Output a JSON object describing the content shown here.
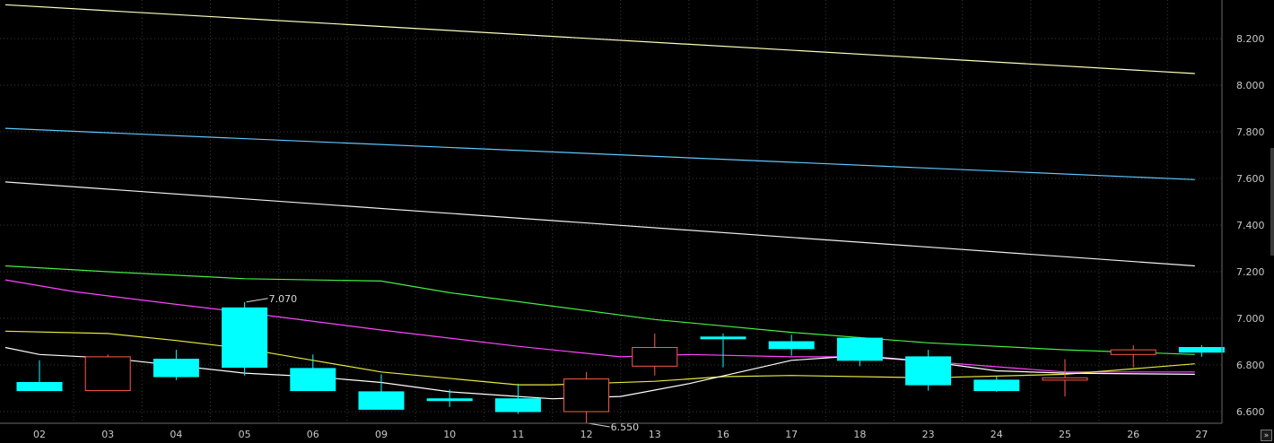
{
  "chart_data": {
    "type": "candlestick",
    "categories": [
      "02",
      "03",
      "04",
      "05",
      "06",
      "09",
      "10",
      "11",
      "12",
      "13",
      "16",
      "17",
      "18",
      "23",
      "24",
      "25",
      "26",
      "27"
    ],
    "ylim": [
      6.56,
      8.3
    ],
    "y_ticks": [
      "8.200",
      "8.000",
      "7.800",
      "7.600",
      "7.400",
      "7.200",
      "7.000",
      "6.800",
      "6.600"
    ],
    "grid": true,
    "colors": {
      "up": "#ff5a4a",
      "down": "#00ffff",
      "background": "#000000",
      "grid": "#3a3a3a",
      "axis_text": "#c8c8c8"
    },
    "candles": [
      {
        "o": 6.725,
        "h": 6.82,
        "l": 6.69,
        "c": 6.69
      },
      {
        "o": 6.69,
        "h": 6.845,
        "l": 6.69,
        "c": 6.835
      },
      {
        "o": 6.825,
        "h": 6.865,
        "l": 6.735,
        "c": 6.75
      },
      {
        "o": 7.045,
        "h": 7.07,
        "l": 6.755,
        "c": 6.79
      },
      {
        "o": 6.785,
        "h": 6.845,
        "l": 6.69,
        "c": 6.69
      },
      {
        "o": 6.685,
        "h": 6.76,
        "l": 6.61,
        "c": 6.61
      },
      {
        "o": 6.655,
        "h": 6.695,
        "l": 6.62,
        "c": 6.655
      },
      {
        "o": 6.655,
        "h": 6.72,
        "l": 6.59,
        "c": 6.6
      },
      {
        "o": 6.6,
        "h": 6.77,
        "l": 6.55,
        "c": 6.74
      },
      {
        "o": 6.795,
        "h": 6.935,
        "l": 6.755,
        "c": 6.875
      },
      {
        "o": 6.92,
        "h": 6.935,
        "l": 6.79,
        "c": 6.92
      },
      {
        "o": 6.9,
        "h": 6.93,
        "l": 6.84,
        "c": 6.87
      },
      {
        "o": 6.915,
        "h": 6.92,
        "l": 6.795,
        "c": 6.82
      },
      {
        "o": 6.835,
        "h": 6.865,
        "l": 6.69,
        "c": 6.715
      },
      {
        "o": 6.735,
        "h": 6.75,
        "l": 6.685,
        "c": 6.69
      },
      {
        "o": 6.735,
        "h": 6.825,
        "l": 6.665,
        "c": 6.745
      },
      {
        "o": 6.845,
        "h": 6.885,
        "l": 6.79,
        "c": 6.865
      },
      {
        "o": 6.875,
        "h": 6.885,
        "l": 6.835,
        "c": 6.855
      }
    ],
    "overlays": [
      {
        "color": "#ffffc0",
        "x": [
          -0.5,
          16.9
        ],
        "y": [
          8.345,
          8.05
        ]
      },
      {
        "color": "#5fc8ff",
        "x": [
          -0.5,
          16.9
        ],
        "y": [
          7.815,
          7.595
        ]
      },
      {
        "color": "#f0f0f0",
        "x": [
          -0.5,
          16.9
        ],
        "y": [
          7.585,
          7.225
        ]
      },
      {
        "color": "#44ee44",
        "x": [
          -0.5,
          1,
          3,
          5,
          6,
          9,
          11,
          13,
          15,
          16.9
        ],
        "y": [
          7.225,
          7.2,
          7.17,
          7.16,
          7.11,
          6.995,
          6.94,
          6.895,
          6.865,
          6.845
        ]
      },
      {
        "color": "#ff44ff",
        "x": [
          -0.5,
          0.5,
          2,
          3,
          5,
          7,
          8.5,
          9.5,
          11,
          12,
          13,
          15,
          16.9
        ],
        "y": [
          7.165,
          7.115,
          7.06,
          7.025,
          6.95,
          6.88,
          6.835,
          6.845,
          6.835,
          6.835,
          6.815,
          6.77,
          6.77
        ]
      },
      {
        "color": "#e8e840",
        "x": [
          -0.5,
          1,
          2,
          3,
          4,
          5,
          7,
          7.5,
          9,
          10,
          11,
          13,
          15,
          16.9
        ],
        "y": [
          6.945,
          6.935,
          6.905,
          6.87,
          6.82,
          6.77,
          6.715,
          6.715,
          6.73,
          6.75,
          6.755,
          6.745,
          6.76,
          6.805
        ]
      },
      {
        "color": "#ffffff",
        "x": [
          -0.5,
          0,
          1,
          3,
          4,
          5,
          6,
          7,
          7.5,
          8.5,
          9.5,
          11,
          12,
          13,
          14,
          15,
          16.9
        ],
        "y": [
          6.875,
          6.845,
          6.83,
          6.765,
          6.75,
          6.725,
          6.685,
          6.665,
          6.655,
          6.665,
          6.72,
          6.82,
          6.84,
          6.815,
          6.775,
          6.765,
          6.76
        ]
      }
    ],
    "annotations": [
      {
        "text": "7.070",
        "index": 3,
        "value": 7.07
      },
      {
        "text": "6.550",
        "index": 8,
        "value": 6.55
      }
    ]
  },
  "controls": {
    "scroll_right_label": "»"
  }
}
